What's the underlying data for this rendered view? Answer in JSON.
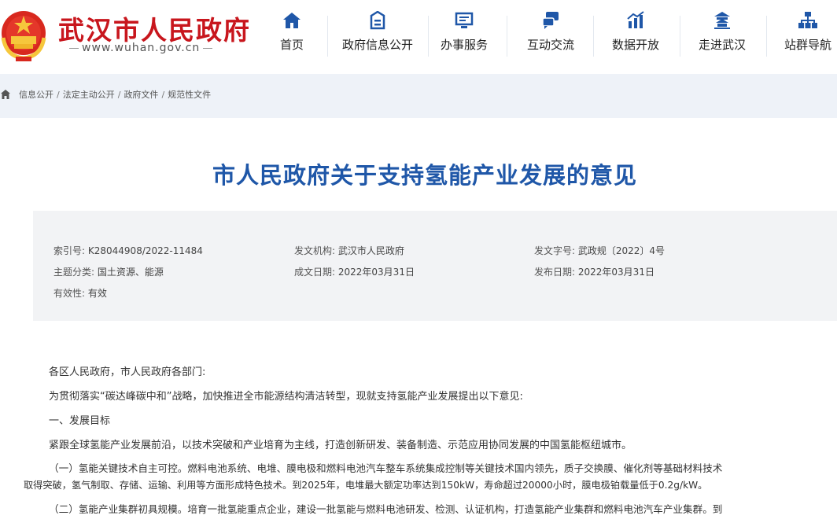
{
  "header": {
    "site_title": "武汉市人民政府",
    "site_url": "www.wuhan.gov.cn",
    "colors": {
      "brand_red": "#c8161d",
      "nav_blue": "#1f57a8"
    }
  },
  "nav": {
    "items": [
      {
        "label": "首页",
        "icon": "home-icon"
      },
      {
        "label": "政府信息公开",
        "icon": "info-public-icon"
      },
      {
        "label": "办事服务",
        "icon": "service-icon"
      },
      {
        "label": "互动交流",
        "icon": "interaction-icon"
      },
      {
        "label": "数据开放",
        "icon": "data-icon"
      },
      {
        "label": "走进武汉",
        "icon": "city-icon"
      },
      {
        "label": "站群导航",
        "icon": "sitemap-icon"
      }
    ]
  },
  "breadcrumb": {
    "items": [
      "信息公开",
      "法定主动公开",
      "政府文件",
      "规范性文件"
    ],
    "separator": "/"
  },
  "document": {
    "title": "市人民政府关于支持氢能产业发展的意见",
    "meta": {
      "index_label": "索引号:",
      "index_value": "K28044908/2022-11484",
      "issuer_label": "发文机构:",
      "issuer_value": "武汉市人民政府",
      "doc_no_label": "发文字号:",
      "doc_no_value": "武政规〔2022〕4号",
      "topic_label": "主题分类:",
      "topic_value": "国土资源、能源",
      "created_label": "成文日期:",
      "created_value": "2022年03月31日",
      "published_label": "发布日期:",
      "published_value": "2022年03月31日",
      "validity_label": "有效性:",
      "validity_value": "有效"
    },
    "paragraphs": [
      "各区人民政府，市人民政府各部门:",
      "为贯彻落实“碳达峰碳中和”战略，加快推进全市能源结构清洁转型，现就支持氢能产业发展提出以下意见:",
      "一、发展目标",
      "紧跟全球氢能产业发展前沿，以技术突破和产业培育为主线，打造创新研发、装备制造、示范应用协同发展的中国氢能枢纽城市。",
      "（一）氢能关键技术自主可控。燃料电池系统、电堆、膜电极和燃料电池汽车整车系统集成控制等关键技术国内领先，质子交换膜、催化剂等基础材料技术",
      "取得突破，氢气制取、存储、运输、利用等方面形成特色技术。到2025年，电堆最大额定功率达到150kW，寿命超过20000小时，膜电极铂载量低于0.2g/kW。",
      "（二）氢能产业集群初具规模。培育一批氢能重点企业，建设一批氢能与燃料电池研发、检测、认证机构，打造氢能产业集群和燃料电池汽车产业集群。到"
    ]
  }
}
